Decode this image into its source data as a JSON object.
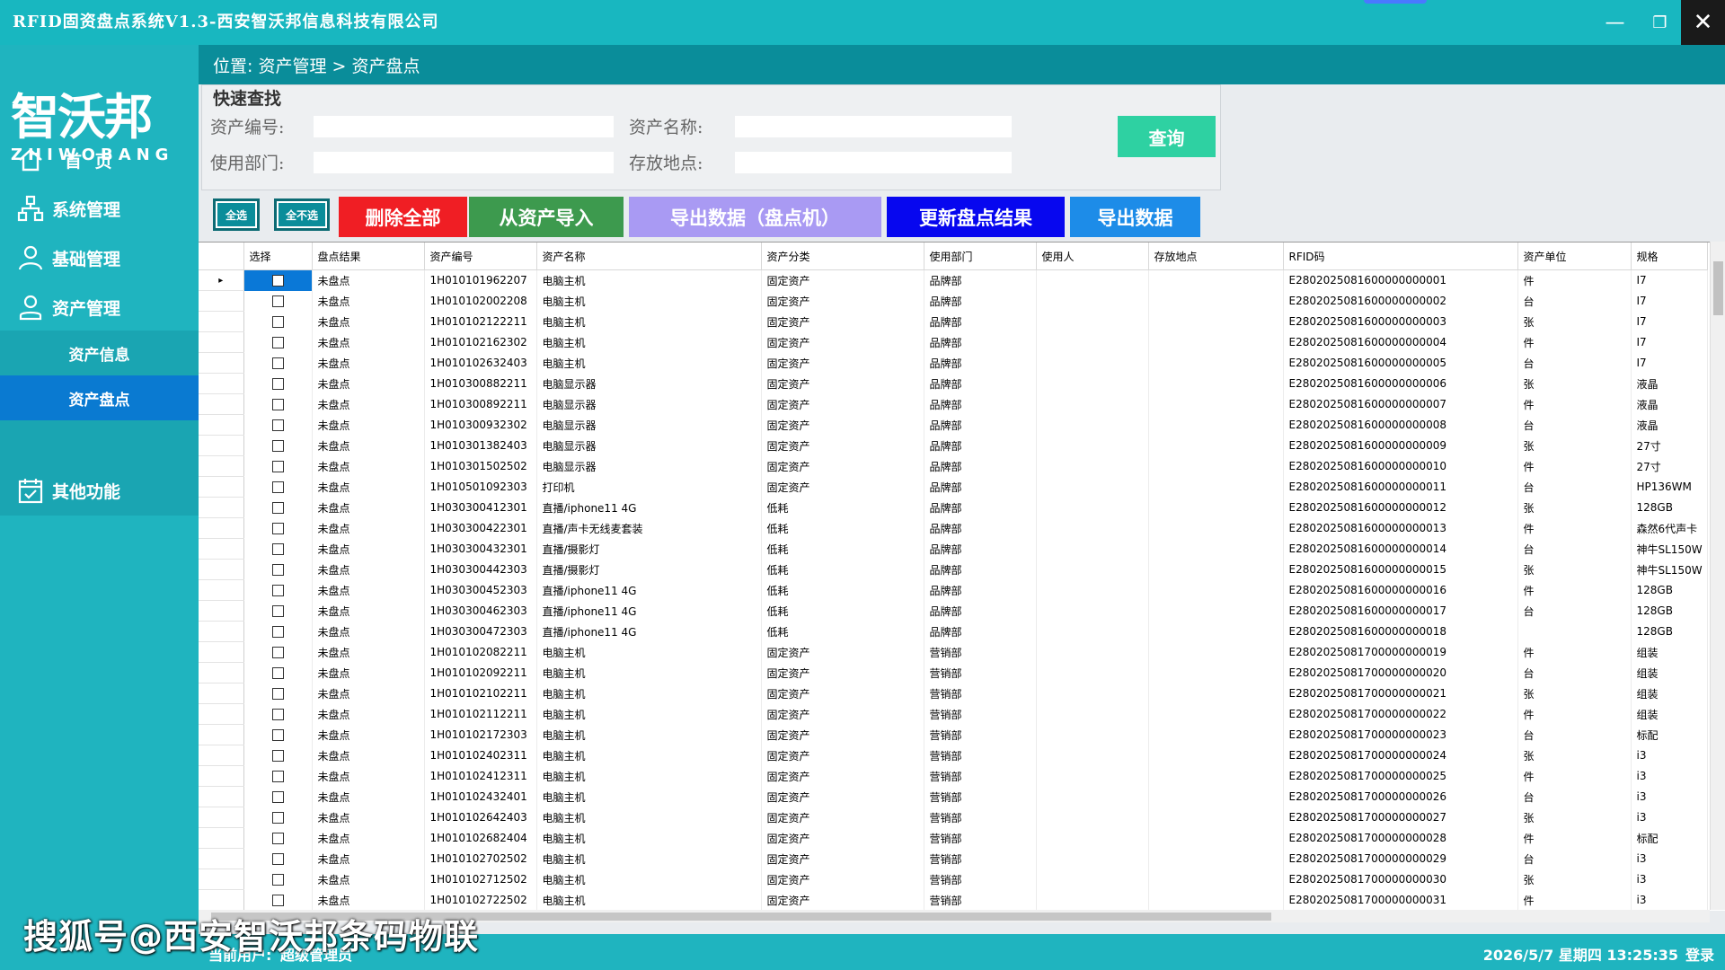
{
  "window": {
    "title": "RFID固资盘点系统V1.3-西安智沃邦信息科技有限公司",
    "minimize": "—",
    "maximize": "❐",
    "close": "✕"
  },
  "logo": {
    "cn": "智沃邦",
    "en": "ZHIWOBANG"
  },
  "sidebar": {
    "items": [
      {
        "label": "首 页",
        "icon": "home-icon"
      },
      {
        "label": "系统管理",
        "icon": "org-chart-icon"
      },
      {
        "label": "基础管理",
        "icon": "user-icon"
      },
      {
        "label": "资产管理",
        "icon": "user-icon"
      }
    ],
    "sub_items": [
      "资产信息",
      "资产盘点"
    ],
    "other": {
      "label": "其他功能",
      "icon": "calendar-check-icon"
    }
  },
  "breadcrumb": "位置: 资产管理 > 资产盘点",
  "search": {
    "legend": "快速查找",
    "asset_no_label": "资产编号:",
    "asset_name_label": "资产名称:",
    "dept_label": "使用部门:",
    "location_label": "存放地点:",
    "asset_no": "",
    "asset_name": "",
    "dept": "",
    "location": "",
    "query_label": "查询"
  },
  "toolbar": {
    "select_all": "全选",
    "select_none": "全不选",
    "delete_all": "删除全部",
    "import_from_assets": "从资产导入",
    "export_to_device": "导出数据（盘点机）",
    "update_results": "更新盘点结果",
    "export_data": "导出数据"
  },
  "colors": {
    "teal": "#1fb4bf",
    "dark_teal": "#0a8d9a",
    "red": "#f01e24",
    "green": "#3d9a4e",
    "lavender": "#a99af3",
    "blue": "#0707ef",
    "light_blue": "#1d8ce8",
    "query": "#2ed1a2",
    "active_menu": "#0a7ad1"
  },
  "table": {
    "columns": [
      "选择",
      "盘点结果",
      "资产编号",
      "资产名称",
      "资产分类",
      "使用部门",
      "使用人",
      "存放地点",
      "RFID码",
      "资产单位",
      "规格"
    ],
    "rows": [
      [
        "未盘点",
        "1H010101962207",
        "电脑主机",
        "固定资产",
        "品牌部",
        "",
        "",
        "E2802025081600000000001",
        "件",
        "I7"
      ],
      [
        "未盘点",
        "1H010102002208",
        "电脑主机",
        "固定资产",
        "品牌部",
        "",
        "",
        "E2802025081600000000002",
        "台",
        "I7"
      ],
      [
        "未盘点",
        "1H010102122211",
        "电脑主机",
        "固定资产",
        "品牌部",
        "",
        "",
        "E2802025081600000000003",
        "张",
        "I7"
      ],
      [
        "未盘点",
        "1H010102162302",
        "电脑主机",
        "固定资产",
        "品牌部",
        "",
        "",
        "E2802025081600000000004",
        "件",
        "I7"
      ],
      [
        "未盘点",
        "1H010102632403",
        "电脑主机",
        "固定资产",
        "品牌部",
        "",
        "",
        "E2802025081600000000005",
        "台",
        "I7"
      ],
      [
        "未盘点",
        "1H010300882211",
        "电脑显示器",
        "固定资产",
        "品牌部",
        "",
        "",
        "E2802025081600000000006",
        "张",
        "液晶"
      ],
      [
        "未盘点",
        "1H010300892211",
        "电脑显示器",
        "固定资产",
        "品牌部",
        "",
        "",
        "E2802025081600000000007",
        "件",
        "液晶"
      ],
      [
        "未盘点",
        "1H010300932302",
        "电脑显示器",
        "固定资产",
        "品牌部",
        "",
        "",
        "E2802025081600000000008",
        "台",
        "液晶"
      ],
      [
        "未盘点",
        "1H010301382403",
        "电脑显示器",
        "固定资产",
        "品牌部",
        "",
        "",
        "E2802025081600000000009",
        "张",
        "27寸"
      ],
      [
        "未盘点",
        "1H010301502502",
        "电脑显示器",
        "固定资产",
        "品牌部",
        "",
        "",
        "E2802025081600000000010",
        "件",
        "27寸"
      ],
      [
        "未盘点",
        "1H010501092303",
        "打印机",
        "固定资产",
        "品牌部",
        "",
        "",
        "E2802025081600000000011",
        "台",
        "HP136WM"
      ],
      [
        "未盘点",
        "1H030300412301",
        "直播/iphone11 4G",
        "低耗",
        "品牌部",
        "",
        "",
        "E2802025081600000000012",
        "张",
        "128GB"
      ],
      [
        "未盘点",
        "1H030300422301",
        "直播/声卡无线麦套装",
        "低耗",
        "品牌部",
        "",
        "",
        "E2802025081600000000013",
        "件",
        "森然6代声卡"
      ],
      [
        "未盘点",
        "1H030300432301",
        "直播/摄影灯",
        "低耗",
        "品牌部",
        "",
        "",
        "E2802025081600000000014",
        "台",
        "神牛SL150W"
      ],
      [
        "未盘点",
        "1H030300442303",
        "直播/摄影灯",
        "低耗",
        "品牌部",
        "",
        "",
        "E2802025081600000000015",
        "张",
        "神牛SL150W"
      ],
      [
        "未盘点",
        "1H030300452303",
        "直播/iphone11 4G",
        "低耗",
        "品牌部",
        "",
        "",
        "E2802025081600000000016",
        "件",
        "128GB"
      ],
      [
        "未盘点",
        "1H030300462303",
        "直播/iphone11 4G",
        "低耗",
        "品牌部",
        "",
        "",
        "E2802025081600000000017",
        "台",
        "128GB"
      ],
      [
        "未盘点",
        "1H030300472303",
        "直播/iphone11 4G",
        "低耗",
        "品牌部",
        "",
        "",
        "E2802025081600000000018",
        "",
        "128GB"
      ],
      [
        "未盘点",
        "1H010102082211",
        "电脑主机",
        "固定资产",
        "营销部",
        "",
        "",
        "E2802025081700000000019",
        "件",
        "组装"
      ],
      [
        "未盘点",
        "1H010102092211",
        "电脑主机",
        "固定资产",
        "营销部",
        "",
        "",
        "E2802025081700000000020",
        "台",
        "组装"
      ],
      [
        "未盘点",
        "1H010102102211",
        "电脑主机",
        "固定资产",
        "营销部",
        "",
        "",
        "E2802025081700000000021",
        "张",
        "组装"
      ],
      [
        "未盘点",
        "1H010102112211",
        "电脑主机",
        "固定资产",
        "营销部",
        "",
        "",
        "E2802025081700000000022",
        "件",
        "组装"
      ],
      [
        "未盘点",
        "1H010102172303",
        "电脑主机",
        "固定资产",
        "营销部",
        "",
        "",
        "E2802025081700000000023",
        "台",
        "标配"
      ],
      [
        "未盘点",
        "1H010102402311",
        "电脑主机",
        "固定资产",
        "营销部",
        "",
        "",
        "E2802025081700000000024",
        "张",
        "i3"
      ],
      [
        "未盘点",
        "1H010102412311",
        "电脑主机",
        "固定资产",
        "营销部",
        "",
        "",
        "E2802025081700000000025",
        "件",
        "i3"
      ],
      [
        "未盘点",
        "1H010102432401",
        "电脑主机",
        "固定资产",
        "营销部",
        "",
        "",
        "E2802025081700000000026",
        "台",
        "i3"
      ],
      [
        "未盘点",
        "1H010102642403",
        "电脑主机",
        "固定资产",
        "营销部",
        "",
        "",
        "E2802025081700000000027",
        "张",
        "i3"
      ],
      [
        "未盘点",
        "1H010102682404",
        "电脑主机",
        "固定资产",
        "营销部",
        "",
        "",
        "E2802025081700000000028",
        "件",
        "标配"
      ],
      [
        "未盘点",
        "1H010102702502",
        "电脑主机",
        "固定资产",
        "营销部",
        "",
        "",
        "E2802025081700000000029",
        "台",
        "i3"
      ],
      [
        "未盘点",
        "1H010102712502",
        "电脑主机",
        "固定资产",
        "营销部",
        "",
        "",
        "E2802025081700000000030",
        "张",
        "i3"
      ],
      [
        "未盘点",
        "1H010102722502",
        "电脑主机",
        "固定资产",
        "营销部",
        "",
        "",
        "E2802025081700000000031",
        "件",
        "i3"
      ]
    ]
  },
  "status": {
    "user_label": "当前用户:",
    "user_value": "超级管理员",
    "datetime": "2026/5/7 星期四 13:25:35",
    "login": "登录"
  },
  "watermark": "搜狐号@西安智沃邦条码物联"
}
